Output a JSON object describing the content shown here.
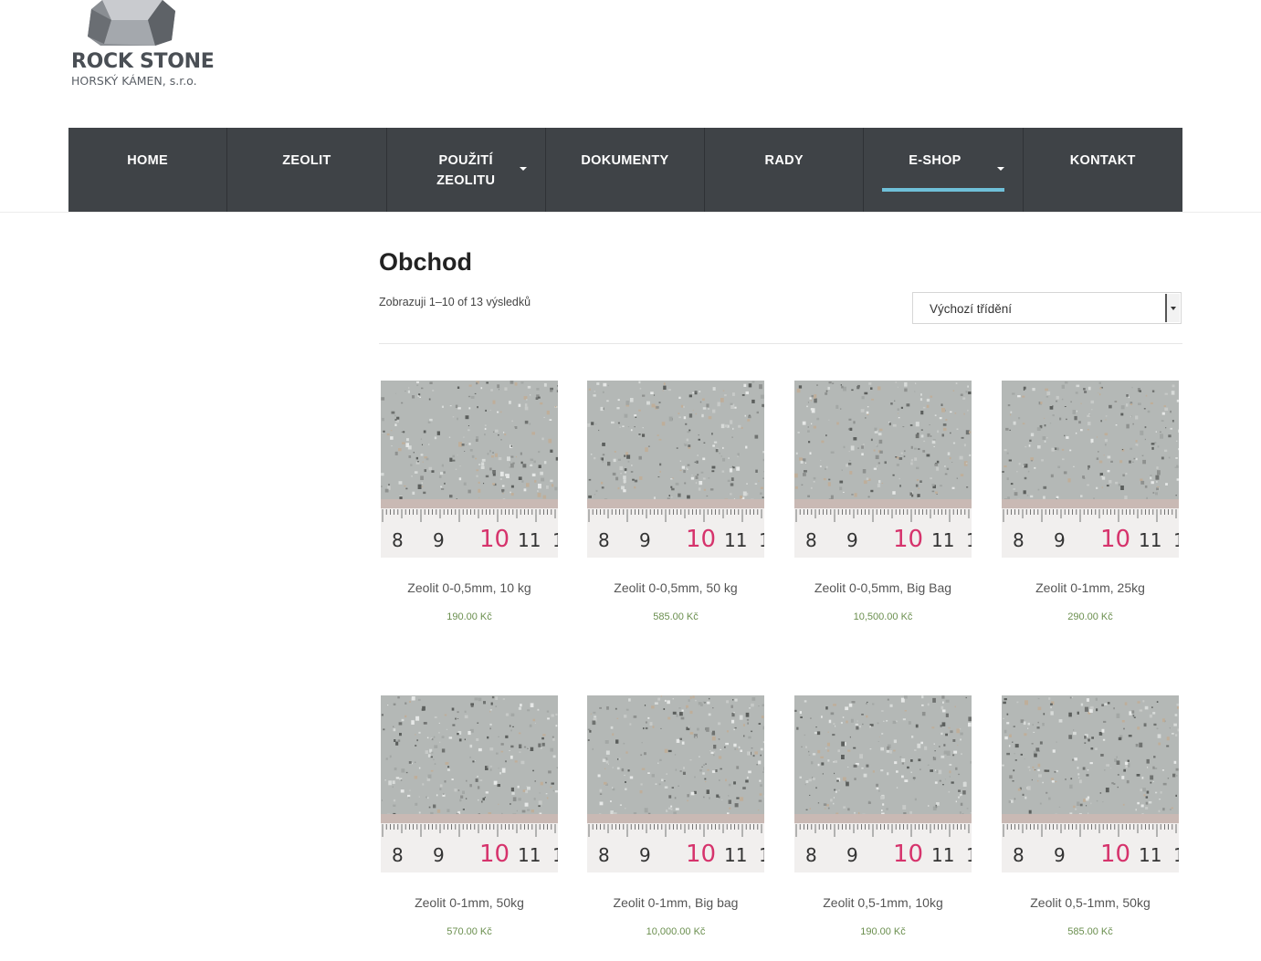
{
  "brand": {
    "title": "ROCK STONE",
    "subtitle": "HORSKÝ KÁMEN, s.r.o."
  },
  "nav": {
    "items": [
      {
        "label": "HOME",
        "dropdown": false,
        "active": false
      },
      {
        "label": "ZEOLIT",
        "dropdown": false,
        "active": false
      },
      {
        "label": "POUŽITÍ ZEOLITU",
        "dropdown": true,
        "active": false
      },
      {
        "label": "DOKUMENTY",
        "dropdown": false,
        "active": false
      },
      {
        "label": "RADY",
        "dropdown": false,
        "active": false
      },
      {
        "label": "E-SHOP",
        "dropdown": true,
        "active": true
      },
      {
        "label": "KONTAKT",
        "dropdown": false,
        "active": false
      }
    ]
  },
  "shop": {
    "title": "Obchod",
    "result_count": "Zobrazuji 1–10 of 13 výsledků",
    "sort_selected": "Výchozí třídění"
  },
  "products": [
    {
      "name": "Zeolit 0-0,5mm, 10 kg",
      "price": "190.00 Kč"
    },
    {
      "name": "Zeolit 0-0,5mm, 50 kg",
      "price": "585.00 Kč"
    },
    {
      "name": "Zeolit 0-0,5mm, Big Bag",
      "price": "10,500.00 Kč"
    },
    {
      "name": "Zeolit 0-1mm, 25kg",
      "price": "290.00 Kč"
    },
    {
      "name": "Zeolit 0-1mm, 50kg",
      "price": "570.00 Kč"
    },
    {
      "name": "Zeolit 0-1mm, Big bag",
      "price": "10,000.00 Kč"
    },
    {
      "name": "Zeolit 0,5-1mm, 10kg",
      "price": "190.00 Kč"
    },
    {
      "name": "Zeolit 0,5-1mm, 50kg",
      "price": "585.00 Kč"
    }
  ],
  "ruler_numbers": [
    "8",
    "9",
    "10",
    "11",
    "1"
  ],
  "colors": {
    "nav_bg": "#3f4347",
    "nav_active_underline": "#6fc0d9",
    "price": "#6b8f4f",
    "ruler_highlight": "#d6336c"
  }
}
